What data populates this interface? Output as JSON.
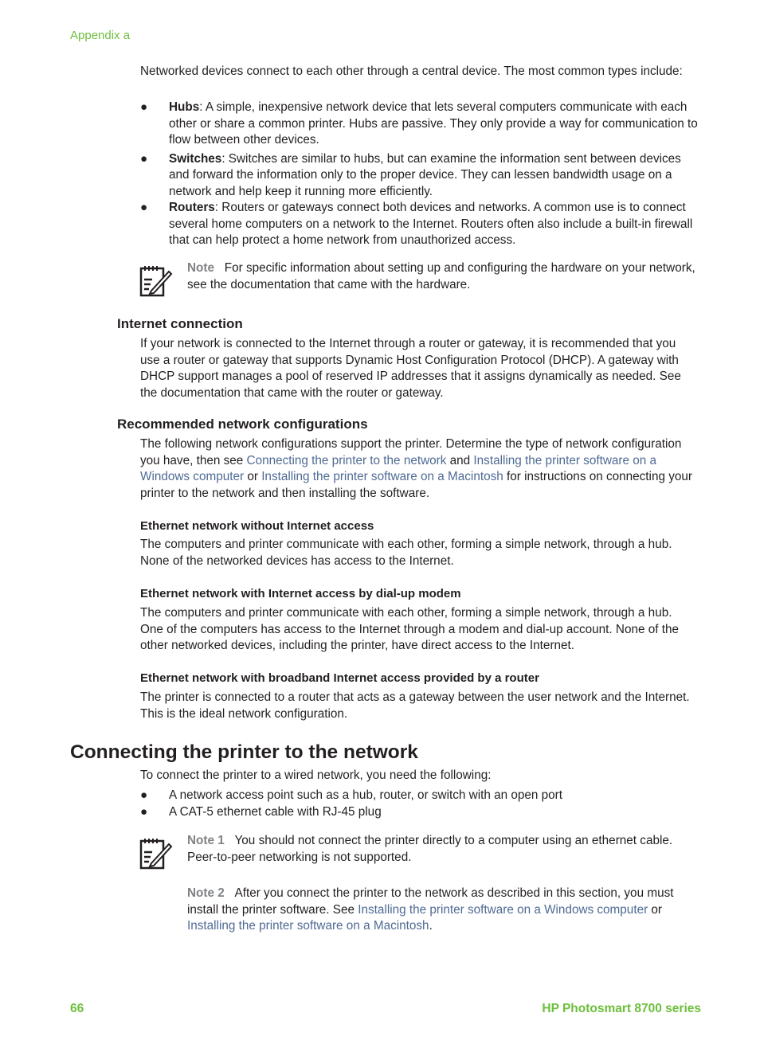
{
  "header": {
    "running_title": "Appendix a"
  },
  "intro": {
    "text": "Networked devices connect to each other through a central device. The most common types include:",
    "bullets": [
      {
        "term": "Hubs",
        "text": ": A simple, inexpensive network device that lets several computers communicate with each other or share a common printer. Hubs are passive. They only provide a way for communication to flow between other devices."
      },
      {
        "term": "Switches",
        "text": ": Switches are similar to hubs, but can examine the information sent between devices and forward the information only to the proper device. They can lessen bandwidth usage on a network and help keep it running more efficiently."
      },
      {
        "term": "Routers",
        "text": ": Routers or gateways connect both devices and networks. A common use is to connect several home computers on a network to the Internet. Routers often also include a built-in firewall that can help protect a home network from unauthorized access."
      }
    ],
    "bullet_glyph": "●"
  },
  "note1": {
    "icon": "note-pencil-icon",
    "label": "Note",
    "text": "For specific information about setting up and configuring the hardware on your network, see the documentation that came with the hardware."
  },
  "internet": {
    "heading": "Internet connection",
    "text": "If your network is connected to the Internet through a router or gateway, it is recommended that you use a router or gateway that supports Dynamic Host Configuration Protocol (DHCP). A gateway with DHCP support manages a pool of reserved IP addresses that it assigns dynamically as needed. See the documentation that came with the router or gateway."
  },
  "recommended": {
    "heading": "Recommended network configurations",
    "text_1": "The following network configurations support the printer. Determine the type of network configuration you have, then see ",
    "link_1": "Connecting the printer to the network",
    "text_2": " and ",
    "link_2": "Installing the printer software on a Windows computer",
    "text_3": " or ",
    "link_3": "Installing the printer software on a Macintosh",
    "text_4": " for instructions on connecting your printer to the network and then installing the software.",
    "configs": [
      {
        "heading": "Ethernet network without Internet access",
        "text": "The computers and printer communicate with each other, forming a simple network, through a hub. None of the networked devices has access to the Internet."
      },
      {
        "heading": "Ethernet network with Internet access by dial-up modem",
        "text": "The computers and printer communicate with each other, forming a simple network, through a hub. One of the computers has access to the Internet through a modem and dial-up account. None of the other networked devices, including the printer, have direct access to the Internet."
      },
      {
        "heading": "Ethernet network with broadband Internet access provided by a router",
        "text": "The printer is connected to a router that acts as a gateway between the user network and the Internet. This is the ideal network configuration."
      }
    ]
  },
  "connecting": {
    "heading": "Connecting the printer to the network",
    "text": "To connect the printer to a wired network, you need the following:",
    "bullets": [
      "A network access point such as a hub, router, or switch with an open port",
      "A CAT-5 ethernet cable with RJ-45 plug"
    ],
    "note_1_label": "Note 1",
    "note_1_text": "You should not connect the printer directly to a computer using an ethernet cable. Peer-to-peer networking is not supported.",
    "note_2_label": "Note 2",
    "note_2_text": "After you connect the printer to the network as described in this section, you must install the printer software. See ",
    "note_2_link_1": "Installing the printer software on a Windows computer",
    "note_2_or": " or ",
    "note_2_link_2": "Installing the printer software on a Macintosh",
    "note_2_end": "."
  },
  "footer": {
    "page_number": "66",
    "product": "HP Photosmart 8700 series"
  },
  "colors": {
    "accent_green": "#6cbf3c",
    "link_blue": "#4f6a94",
    "note_gray": "#808285"
  }
}
